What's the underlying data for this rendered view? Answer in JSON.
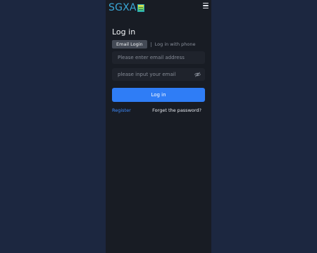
{
  "brand": {
    "logo_text": "SGXA",
    "logo_color": "#3aa7d6"
  },
  "header": {
    "menu_icon": "menu-icon"
  },
  "login": {
    "title": "Log in",
    "tabs": [
      {
        "label": "Email Login",
        "active": true
      },
      {
        "label": "Log in with phone",
        "active": false
      }
    ],
    "email": {
      "placeholder": "Please enter email address",
      "value": ""
    },
    "password": {
      "placeholder": "please input your email",
      "value": "",
      "toggle_icon": "eye-off-icon"
    },
    "submit_label": "Log in",
    "register_label": "Register",
    "forgot_label": "Forget the password?"
  },
  "colors": {
    "background": "#1c2740",
    "panel": "#181c24",
    "accent": "#2f7df6",
    "link": "#3d8bff"
  }
}
